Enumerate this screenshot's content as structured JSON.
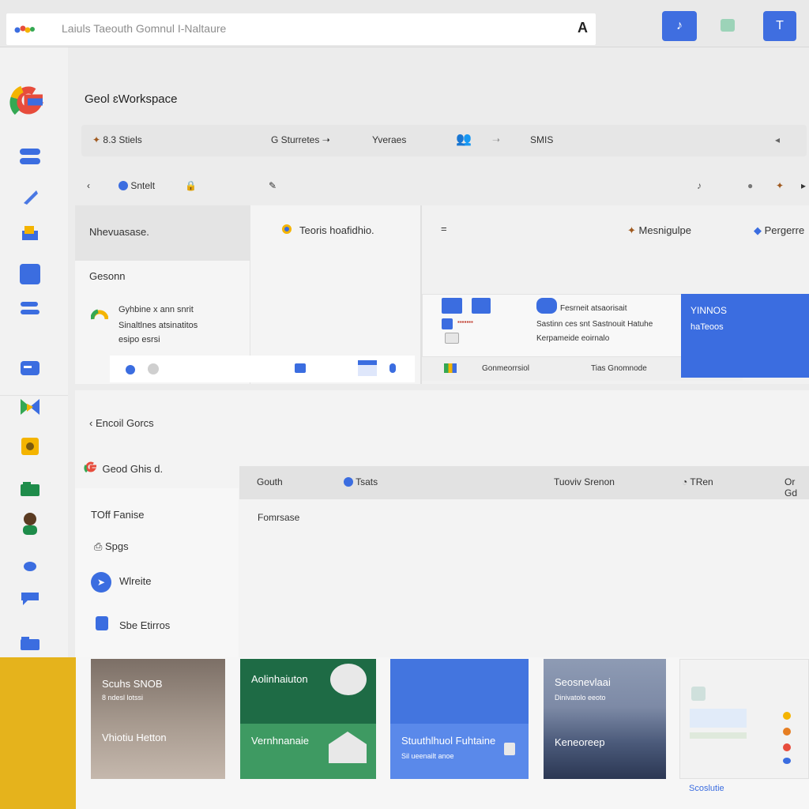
{
  "topbar": {
    "address_text": "Laiuls Taeouth Gomnul I-Naltaure",
    "account_glyph": "A",
    "btn_left_glyph": "♪",
    "btn_right_glyph": "T"
  },
  "header": {
    "workspace_title": "Geol ɛWorkspace"
  },
  "filters": [
    {
      "label": "8.3 Stiels"
    },
    {
      "label": "G Sturretes"
    },
    {
      "label": "Yveraes"
    },
    {
      "label": "SMIS"
    }
  ],
  "subbar": {
    "back": "‹",
    "email_label": "Sntelt",
    "edit_glyph": "✎"
  },
  "upper_panel": {
    "left_heading": "Nhevuasase.",
    "left_section": "Gesonn",
    "left_body_lines": [
      "Gyhbine x ann snrit",
      "Sinaltlnes atsinatitos",
      "esipo esrsi"
    ],
    "mid_heading": "Teoris hoafidhio.",
    "right_icon_label": "=",
    "right_col1": "Mesnigulpe",
    "right_col2": "Pergerre",
    "mini_rows": [
      "Fesrneit atsaorisait",
      "Sastinn ces snt Sastnouit Hatuhe",
      "Kerpameide eoirnalo"
    ],
    "mini_footer_left": "Gonmeorrsiol",
    "mini_footer_right": "Tias Gnomnode",
    "blue_card_title": "YINNOS",
    "blue_card_sub": "haTeoos"
  },
  "lower_panel": {
    "section_title": "Encoil Gorcs",
    "left_brand": "Geod Ghis d.",
    "items": [
      "TOff Fanise",
      "Spgs",
      "Wlreite",
      "Sbe Etirros"
    ],
    "table_headers": [
      "Gouth",
      "Tsats",
      "Tuoviv Srenon",
      "TRen",
      "Or Gd"
    ],
    "table_row_label": "Fomrsase"
  },
  "cards": [
    {
      "title": "Scuhs SNOB",
      "sub": "8 ndesl lotssi",
      "title2": "Vhiotiu Hetton"
    },
    {
      "title": "Aolinhaiuton",
      "sub": "",
      "title2": "Vernhnanaie"
    },
    {
      "title": "Stuuthlhuol Fuhtaine",
      "sub": "Sil ueenailt anoe",
      "title2": ""
    },
    {
      "title": "Seosnevlaai",
      "sub": "Dinivatolo eeoto",
      "title2": "Keneoreep"
    }
  ],
  "bottom_link": "Scoslutie",
  "colors": {
    "accent_blue": "#3b6de0",
    "green_card": "#1e6b45",
    "yellow": "#e5b31c"
  },
  "icons": [
    "google-logo-icon",
    "chat-icon",
    "pen-icon",
    "folder-icon",
    "doc-icon",
    "list-icon",
    "meet-icon",
    "notes-icon",
    "briefcase-icon",
    "avatar-icon",
    "dot-icon",
    "message-icon",
    "folder-small-icon"
  ]
}
